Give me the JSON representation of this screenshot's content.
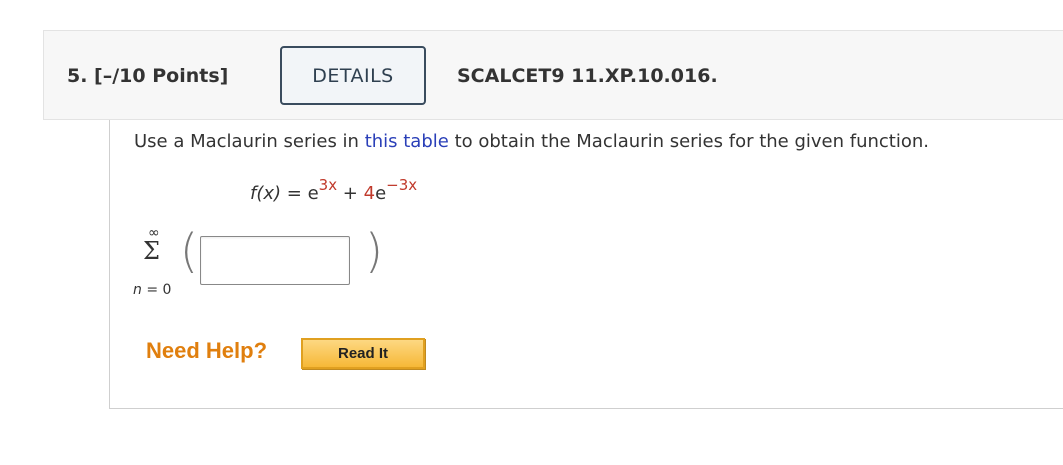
{
  "question": {
    "number_label": "5. [–/10 Points]",
    "details_label": "DETAILS",
    "assignment_code": "SCALCET9 11.XP.10.016."
  },
  "problem": {
    "instruction_before": "Use a Maclaurin series in ",
    "instruction_link": "this table",
    "instruction_after": " to obtain the Maclaurin series for the given function.",
    "function": {
      "lhs": "f(x)",
      "equals": " = ",
      "base1": "e",
      "exp1": "3x",
      "plus": " + ",
      "coef2": "4",
      "base2": "e",
      "exp2": "−3x"
    },
    "sum": {
      "upper": "∞",
      "symbol": "Σ",
      "lower_var": "n",
      "lower_rest": " = 0",
      "left_paren": "(",
      "right_paren": ")",
      "answer_value": ""
    }
  },
  "help": {
    "need_help_label": "Need Help?",
    "read_it_label": "Read It"
  },
  "colors": {
    "link": "#2a3fb8",
    "highlight_red": "#c0392b",
    "need_help_orange": "#e07f0e",
    "read_it_button": "#f6b837"
  }
}
